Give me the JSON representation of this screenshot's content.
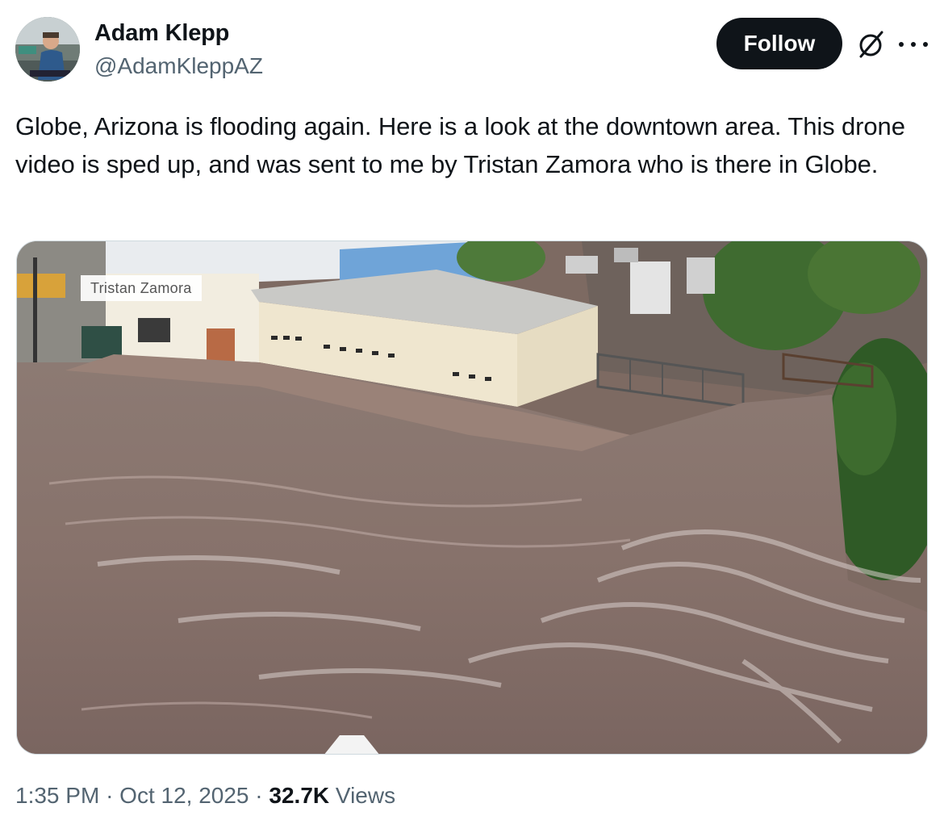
{
  "author": {
    "display_name": "Adam Klepp",
    "handle": "@AdamKleppAZ"
  },
  "actions": {
    "follow_label": "Follow",
    "grok_icon": "grok-slash-icon",
    "more_icon": "more-horizontal-icon"
  },
  "tweet": {
    "text": "Globe, Arizona is flooding again. Here is a look at the downtown area. This drone video is sped up, and was sent to me by Tristan Zamora who is there in Globe."
  },
  "media": {
    "watermark": "Tristan Zamora"
  },
  "meta": {
    "time": "1:35 PM",
    "separator": "·",
    "date": "Oct 12, 2025",
    "views_count": "32.7K",
    "views_label": "Views"
  },
  "colors": {
    "follow_bg": "#0f1419",
    "secondary_text": "#536471",
    "floodwater": "#8a7670"
  }
}
